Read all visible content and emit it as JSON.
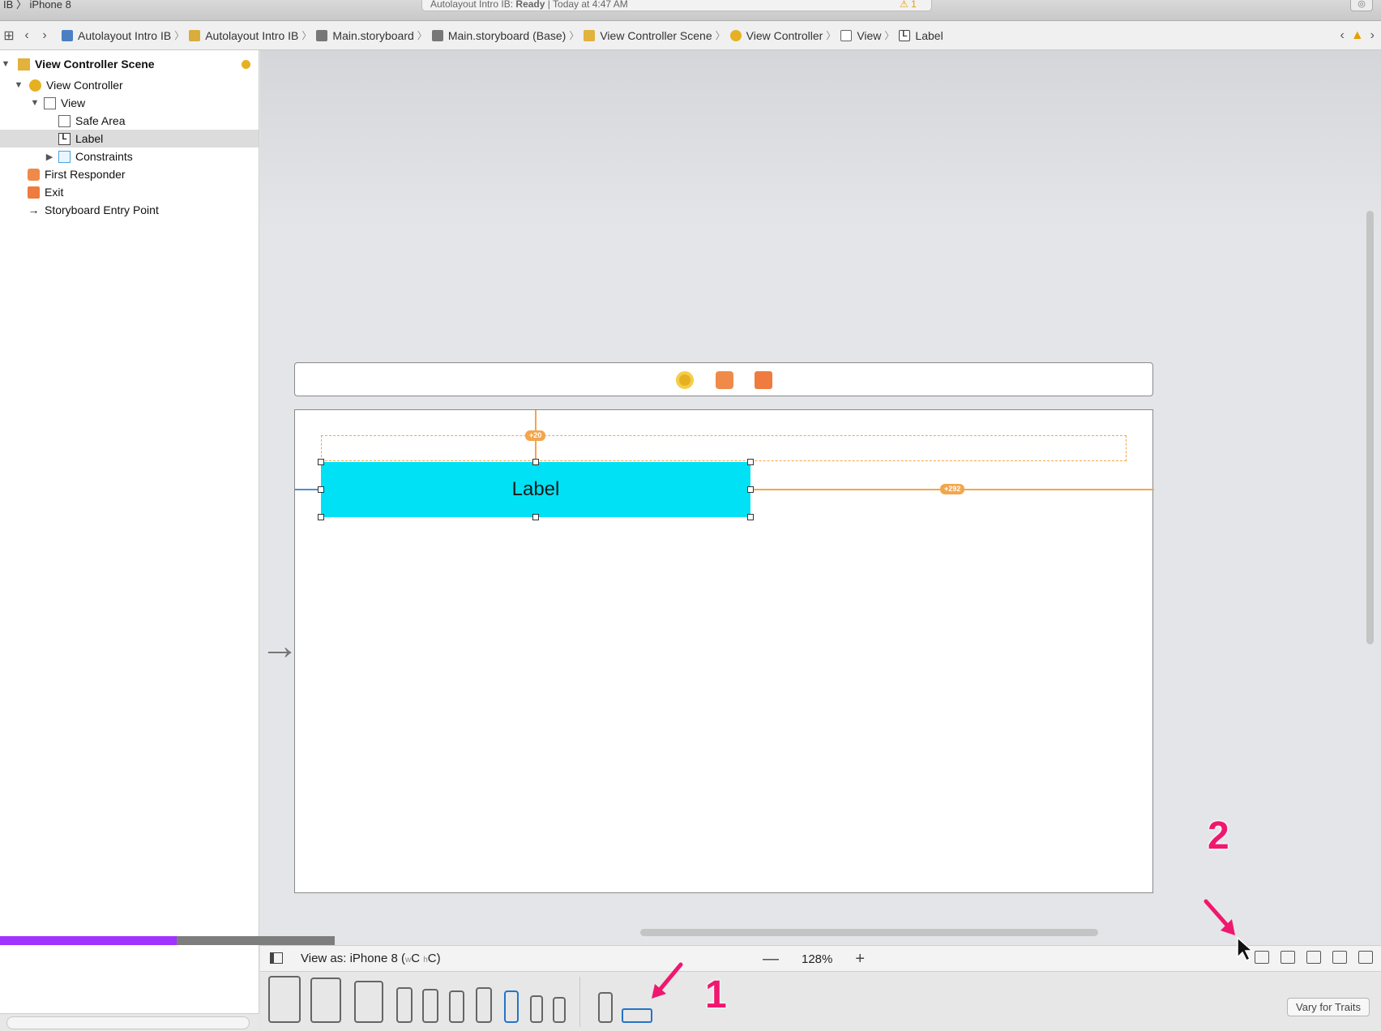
{
  "toolbar": {
    "scheme_device": "IB 〉 iPhone 8",
    "status_prefix": "Autolayout Intro IB: ",
    "status_state": "Ready",
    "status_time": "|  Today at 4:47 AM",
    "warning_count": "⚠ 1"
  },
  "jumpbar": {
    "crumbs": [
      "Autolayout Intro IB",
      "Autolayout Intro IB",
      "Main.storyboard",
      "Main.storyboard (Base)",
      "View Controller Scene",
      "View Controller",
      "View",
      "Label"
    ]
  },
  "outline": {
    "scene": "View Controller Scene",
    "view_controller": "View Controller",
    "view": "View",
    "safe_area": "Safe Area",
    "label": "Label",
    "constraints": "Constraints",
    "first_responder": "First Responder",
    "exit": "Exit",
    "entry_point": "Storyboard Entry Point"
  },
  "canvas": {
    "label_text": "Label",
    "top_constraint": "+20",
    "trailing_constraint": "+292"
  },
  "bottombar": {
    "view_as_prefix": "View as: iPhone 8 (",
    "size_w": "w",
    "size_w_class": "C",
    "size_h": "h",
    "size_h_class": "C",
    "view_as_suffix": ")",
    "zoom": "128%",
    "zoom_out": "—",
    "zoom_in": "+"
  },
  "devicebar": {
    "vary_for_traits": "Vary for Traits"
  },
  "annotations": {
    "one": "1",
    "two": "2"
  },
  "colors": {
    "label_bg": "#00e1f5",
    "constraint": "#f2a64c",
    "annotation": "#f0176e",
    "progress": "#a132ff"
  }
}
